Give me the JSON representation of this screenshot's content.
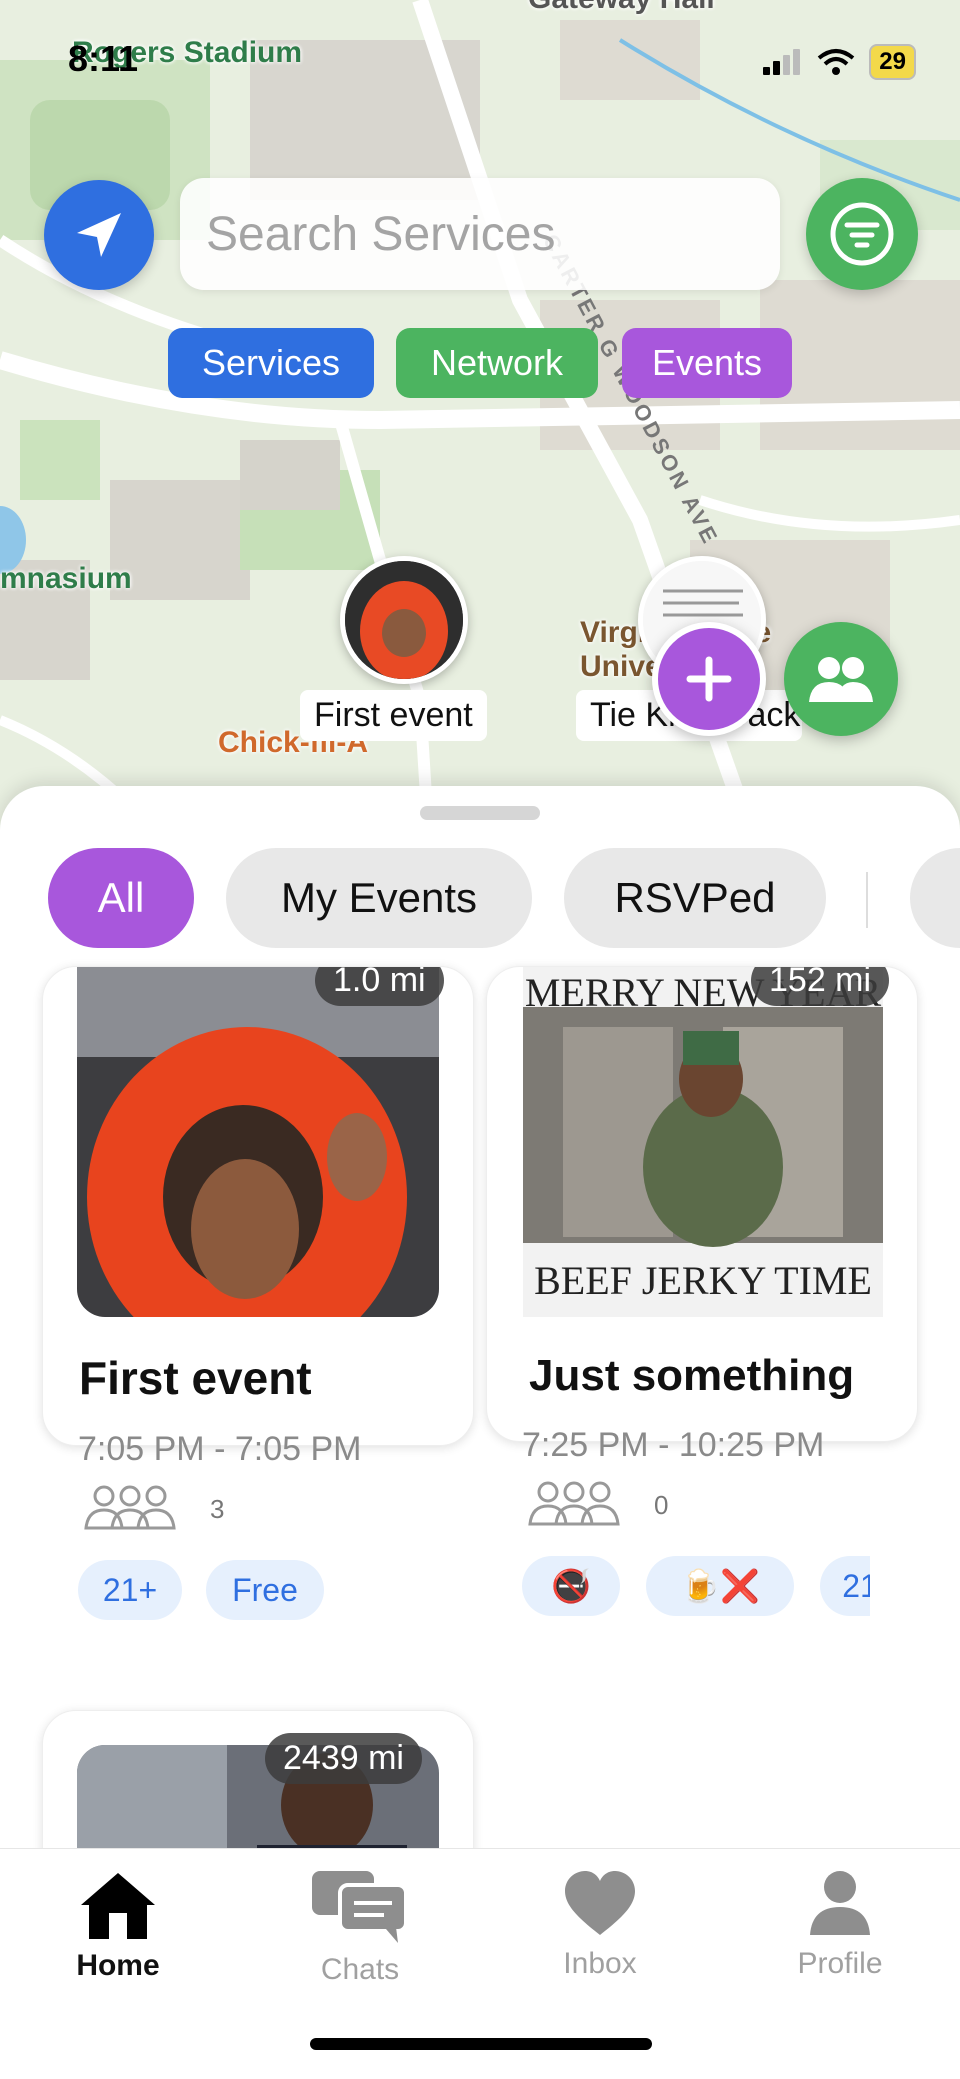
{
  "status_bar": {
    "time": "8:11",
    "battery": "29"
  },
  "map": {
    "labels": {
      "stadium": "Rogers Stadium",
      "gateway": "Gateway Hall",
      "gymnasium": "mnasium",
      "road": "CARTER G WOODSON AVE",
      "university": "Virginia State University",
      "chickfila": "Chick-fil-A"
    },
    "markers": [
      {
        "label": "First event"
      },
      {
        "label": "Tie Knot Back"
      }
    ]
  },
  "search": {
    "placeholder": "Search Services"
  },
  "chips": {
    "services": "Services",
    "network": "Network",
    "events": "Events"
  },
  "segments": {
    "all": "All",
    "my_events": "My Events",
    "rsvped": "RSVPed"
  },
  "cards": [
    {
      "distance": "1.0 mi",
      "title": "First event",
      "time": "7:05 PM - 7:05 PM",
      "attendees": "3",
      "tags": [
        "21+",
        "Free"
      ]
    },
    {
      "distance": "152 mi",
      "image_text_top": "MERRY NEW YEAR",
      "image_text_bottom": "BEEF JERKY TIME",
      "title": "Just something",
      "time": "7:25 PM - 10:25 PM",
      "attendees": "0",
      "tags": [
        "🚭",
        "🍺❌",
        "21"
      ]
    },
    {
      "distance": "2439 mi"
    }
  ],
  "tabs": {
    "home": "Home",
    "chats": "Chats",
    "inbox": "Inbox",
    "profile": "Profile"
  },
  "colors": {
    "blue": "#2f6fe0",
    "green": "#4cb460",
    "purple": "#a857dc"
  }
}
